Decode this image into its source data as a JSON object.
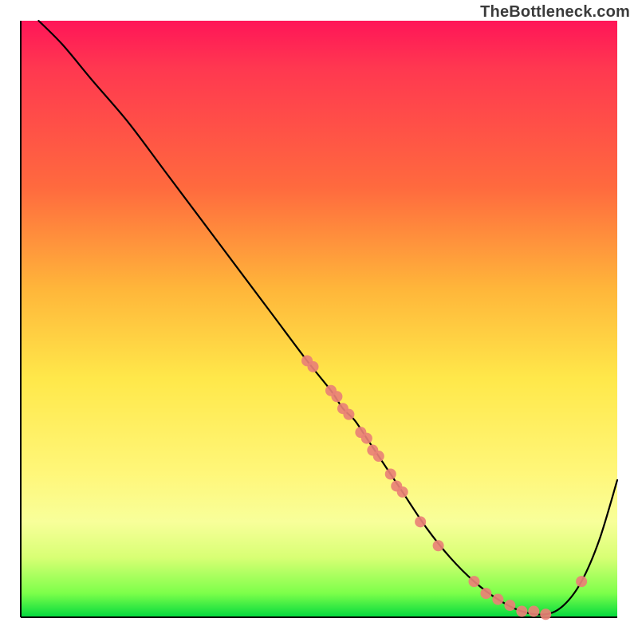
{
  "watermark": "TheBottleneck.com",
  "chart_data": {
    "type": "line",
    "title": "",
    "xlabel": "",
    "ylabel": "",
    "xlim": [
      0,
      100
    ],
    "ylim": [
      0,
      100
    ],
    "grid": false,
    "legend": false,
    "series": [
      {
        "name": "curve",
        "x": [
          3,
          7,
          12,
          18,
          24,
          30,
          36,
          42,
          48,
          52,
          54,
          56,
          58,
          60,
          62,
          64,
          68,
          72,
          76,
          80,
          84,
          88,
          91,
          94,
          97,
          100
        ],
        "y": [
          100,
          96,
          90,
          83,
          75,
          67,
          59,
          51,
          43,
          38,
          35,
          33,
          30,
          27,
          24,
          21,
          15,
          10,
          6,
          3,
          1,
          0.5,
          2,
          6,
          13,
          23
        ],
        "color": "#000000"
      },
      {
        "name": "markers",
        "type": "scatter",
        "x": [
          48,
          49,
          52,
          53,
          54,
          55,
          57,
          58,
          59,
          60,
          62,
          63,
          64,
          67,
          70,
          76,
          78,
          80,
          82,
          84,
          86,
          88,
          94
        ],
        "y": [
          43,
          42,
          38,
          37,
          35,
          34,
          31,
          30,
          28,
          27,
          24,
          22,
          21,
          16,
          12,
          6,
          4,
          3,
          2,
          1,
          1,
          0.5,
          6
        ],
        "color": "#e98176"
      }
    ],
    "background_gradient": {
      "direction": "vertical",
      "stops": [
        {
          "pos": 0,
          "color": "#ff1558"
        },
        {
          "pos": 28,
          "color": "#ff6a3e"
        },
        {
          "pos": 60,
          "color": "#ffe84a"
        },
        {
          "pos": 90,
          "color": "#d8ff74"
        },
        {
          "pos": 100,
          "color": "#02d93e"
        }
      ]
    },
    "axes": {
      "x": {
        "visible": true,
        "ticks": false
      },
      "y": {
        "visible": true,
        "ticks": false
      }
    }
  }
}
